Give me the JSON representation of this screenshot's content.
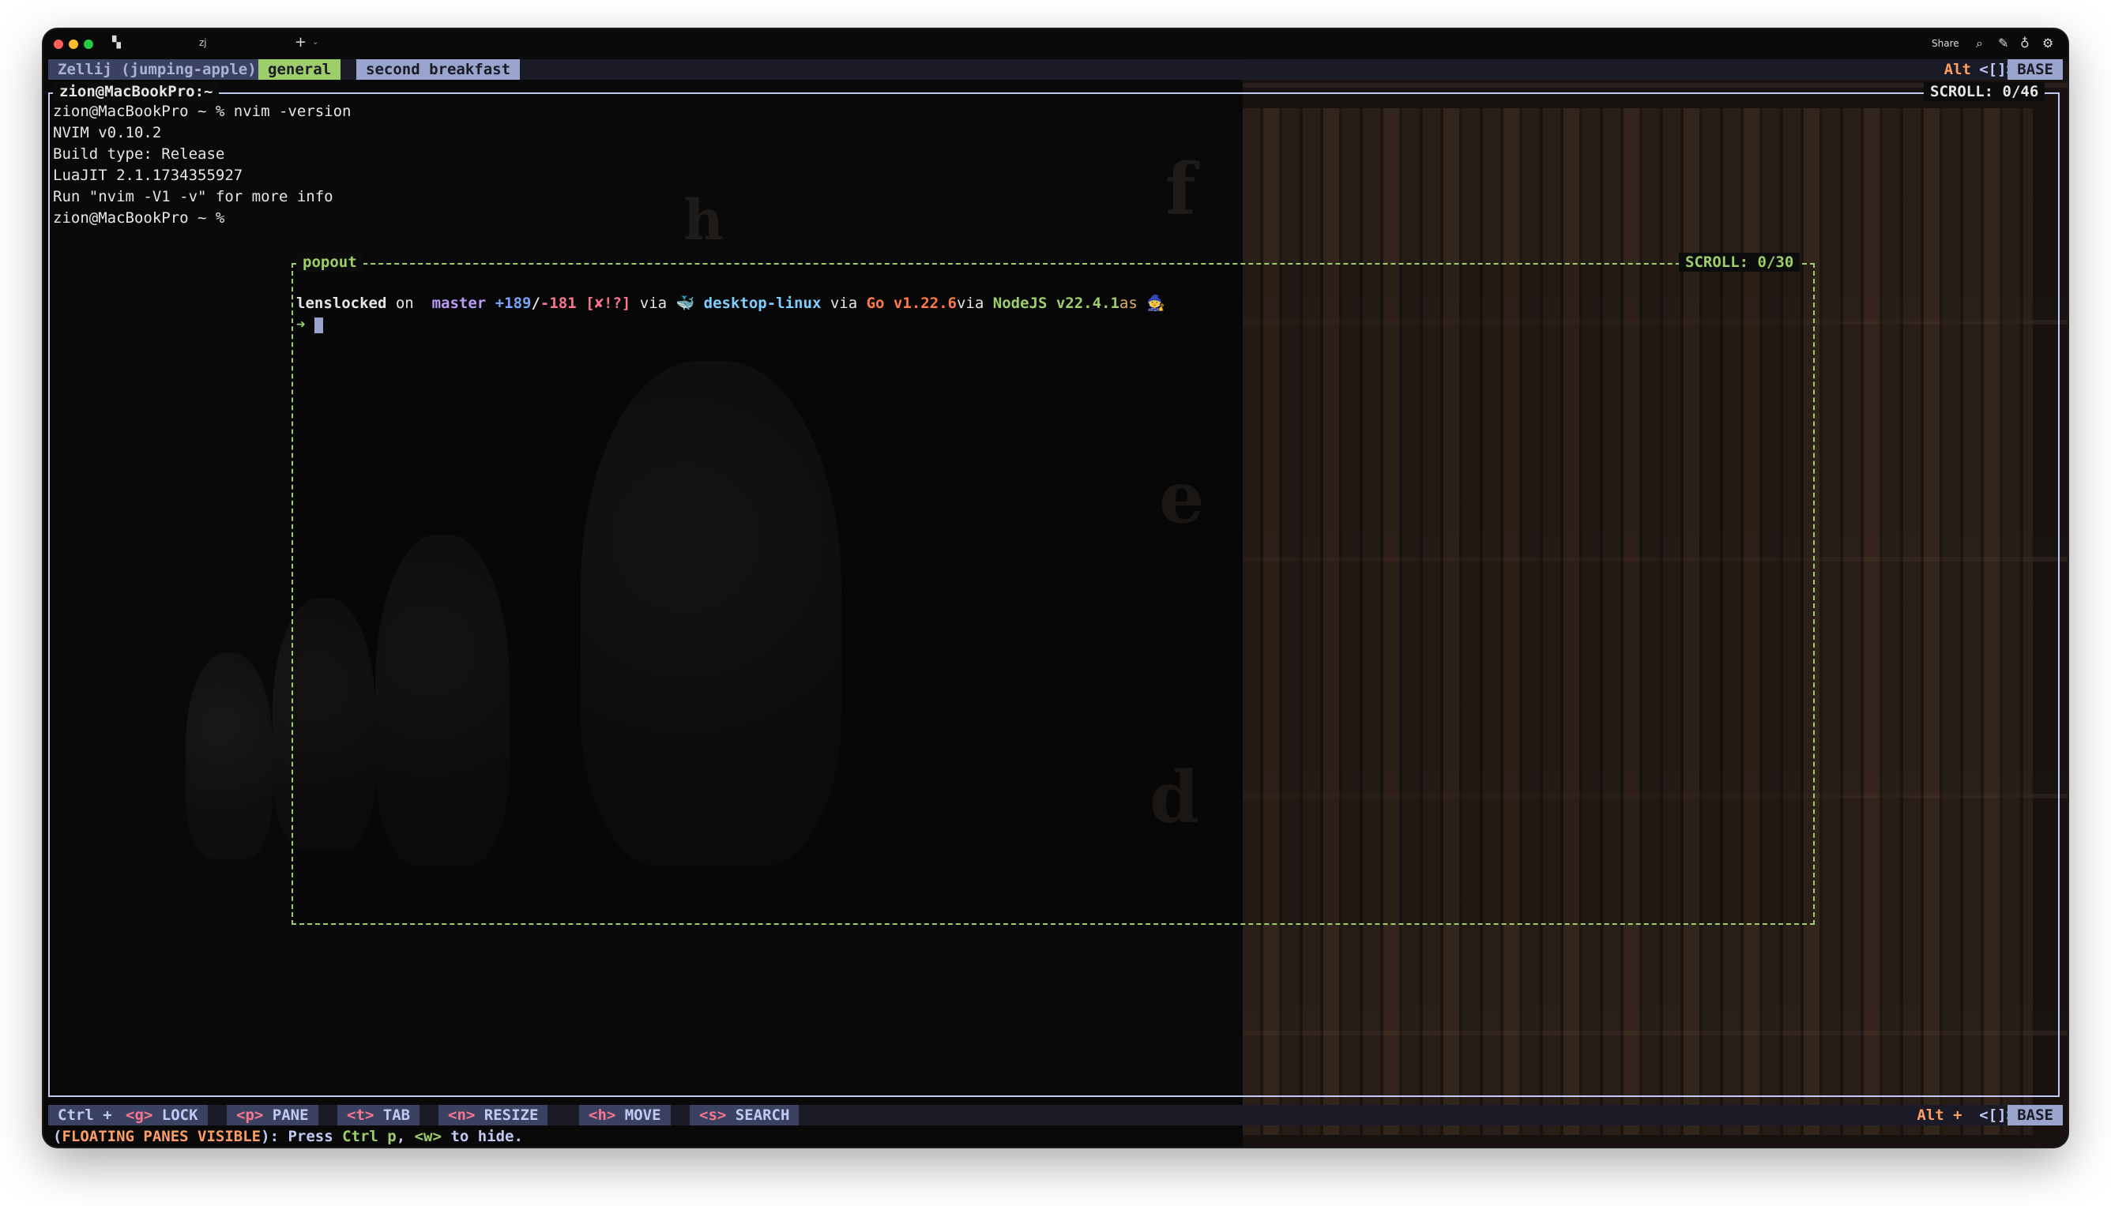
{
  "titlebar": {
    "tab_title": "zj",
    "share_label": "Share"
  },
  "top_bar": {
    "session": "Zellij (jumping-apple)",
    "tabs": [
      "general",
      "second breakfast"
    ],
    "right_mod": "Alt",
    "right_keys": "<[]>",
    "mode": "BASE"
  },
  "main_pane": {
    "title": "zion@MacBookPro:~",
    "scroll_label": "SCROLL:",
    "scroll_value": "0/46",
    "lines": [
      "zion@MacBookPro ~ % ",
      "NVIM v0.10.2",
      "Build type: Release",
      "LuaJIT 2.1.1734355927",
      "Run \"nvim -V1 -v\" for more info",
      "zion@MacBookPro ~ %"
    ],
    "command": "nvim -version"
  },
  "popout": {
    "title": "popout",
    "scroll_label": "SCROLL:",
    "scroll_value": "0/30",
    "prompt": {
      "dir": "lenslocked",
      "on": " on ",
      "branch_icon": "",
      "branch": "master",
      "added": "+189",
      "slash": "/",
      "removed": "-181",
      "status": "[✘!?]",
      "via1": " via ",
      "docker_icon": "🐳",
      "docker": "desktop-linux",
      "via2": " via ",
      "go": "Go v1.22.6",
      "via3": "via ",
      "node": "NodeJS v22.4.1",
      "as": "as",
      "user_icon": "🧙",
      "arrow": "➜"
    }
  },
  "bottom_bar": {
    "mod": "Ctrl +",
    "keys": [
      {
        "key": "<g>",
        "label": "LOCK"
      },
      {
        "key": "<p>",
        "label": "PANE"
      },
      {
        "key": "<t>",
        "label": "TAB"
      },
      {
        "key": "<n>",
        "label": "RESIZE"
      },
      {
        "key": "<h>",
        "label": "MOVE"
      },
      {
        "key": "<s>",
        "label": "SEARCH"
      }
    ],
    "right_mod": "Alt + ",
    "right_keys": "<[]>",
    "mode": "BASE"
  },
  "hint": {
    "open": "(",
    "state": "FLOATING PANES VISIBLE",
    "mid": "): Press ",
    "key1": "Ctrl p",
    "sep": ", ",
    "key2": "<w>",
    "end": " to hide."
  },
  "colors": {
    "accent_green": "#9ece6a",
    "accent_orange": "#ff9e64",
    "bar_bg": "#3b4261",
    "key_red": "#f7768e",
    "text_light": "#c0caf5"
  }
}
